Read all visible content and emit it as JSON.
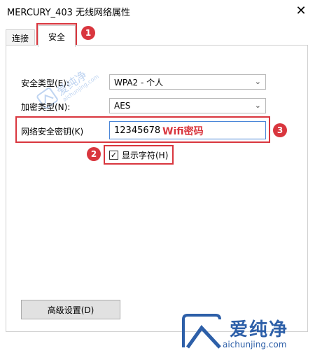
{
  "window": {
    "title": "MERCURY_403 无线网络属性",
    "close_glyph": "✕"
  },
  "tabs": [
    {
      "label": "连接",
      "selected": false
    },
    {
      "label": "安全",
      "selected": true
    }
  ],
  "form": {
    "security_type": {
      "label": "安全类型(E):",
      "value": "WPA2 - 个人"
    },
    "encryption_type": {
      "label": "加密类型(N):",
      "value": "AES"
    },
    "network_key": {
      "label": "网络安全密钥(K)",
      "value": "12345678"
    },
    "show_chars": {
      "label": "显示字符(H)",
      "checked": true,
      "check_glyph": "✓"
    },
    "advanced_button": {
      "label": "高级设置(D)"
    }
  },
  "annotations": {
    "badge_1": "1",
    "badge_2": "2",
    "badge_3": "3",
    "wifi_note": "Wifi密码",
    "accent_color": "#d9363e"
  },
  "watermarks": {
    "mid_text": "爱纯净",
    "mid_url": "aichunjing.com",
    "logo_text": "爱纯净",
    "logo_url": "aichunjing.com",
    "logo_color": "#2d5fa8"
  },
  "icons": {
    "close": "close-icon",
    "dropdown": "chevron-down-icon",
    "check": "checkmark-icon",
    "logo": "aichunjing-logo-icon"
  }
}
